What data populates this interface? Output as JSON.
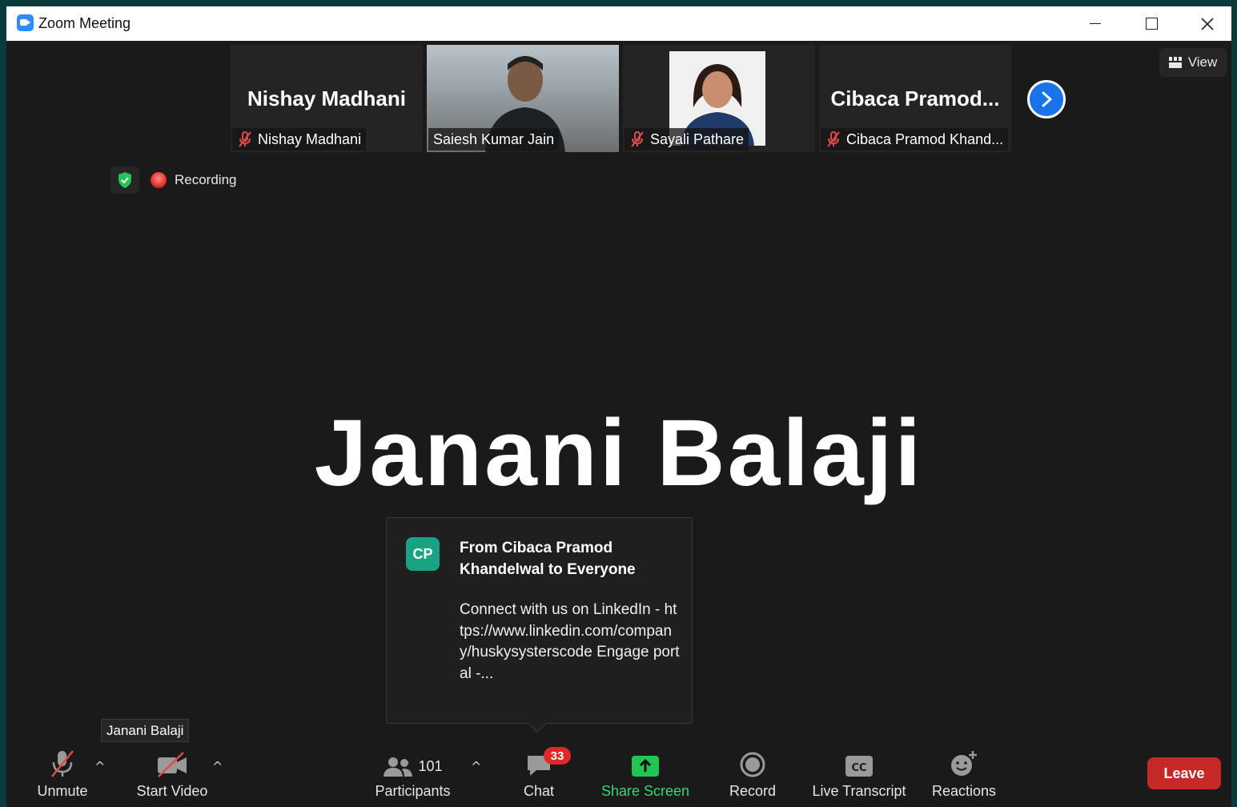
{
  "window": {
    "title": "Zoom Meeting"
  },
  "gallery": [
    {
      "big_name": "Nishay Madhani",
      "label": "Nishay Madhani",
      "muted": true
    },
    {
      "big_name": "",
      "label": "Saiesh Kumar Jain",
      "muted": false
    },
    {
      "big_name": "",
      "label": "Sayali Pathare",
      "muted": true
    },
    {
      "big_name": "Cibaca  Pramod...",
      "label": "Cibaca Pramod Khand...",
      "muted": true
    }
  ],
  "view_button": {
    "label": "View"
  },
  "recording": {
    "label": "Recording"
  },
  "active_speaker": {
    "name": "Janani Balaji"
  },
  "chat_popup": {
    "avatar_initials": "CP",
    "from": "From Cibaca Pramod Khandelwal to Everyone",
    "message": "Connect with us on LinkedIn - https://www.linkedin.com/company/huskysysterscode Engage portal -..."
  },
  "tooltip": {
    "text": "Janani Balaji"
  },
  "toolbar": {
    "unmute": "Unmute",
    "start_video": "Start Video",
    "participants": "Participants",
    "participants_count": "101",
    "chat": "Chat",
    "chat_badge": "33",
    "share_screen": "Share Screen",
    "record": "Record",
    "live_transcript": "Live Transcript",
    "reactions": "Reactions",
    "leave": "Leave"
  },
  "colors": {
    "background": "#1a1a1a",
    "share_green": "#37d67a",
    "leave_red": "#c62828",
    "badge_red": "#e02828",
    "muted_icon_red": "#e04a4a",
    "avatar_teal": "#1aa383",
    "accent_blue": "#1a73e8"
  },
  "icons": [
    "zoom-app-icon",
    "minimize-icon",
    "maximize-icon",
    "close-icon",
    "mic-muted-icon",
    "next-arrow-icon",
    "view-grid-icon",
    "shield-check-icon",
    "recording-dot-icon",
    "video-muted-icon",
    "participants-icon",
    "chat-icon",
    "share-screen-icon",
    "record-icon",
    "closed-caption-icon",
    "reactions-icon",
    "caret-up-icon"
  ]
}
